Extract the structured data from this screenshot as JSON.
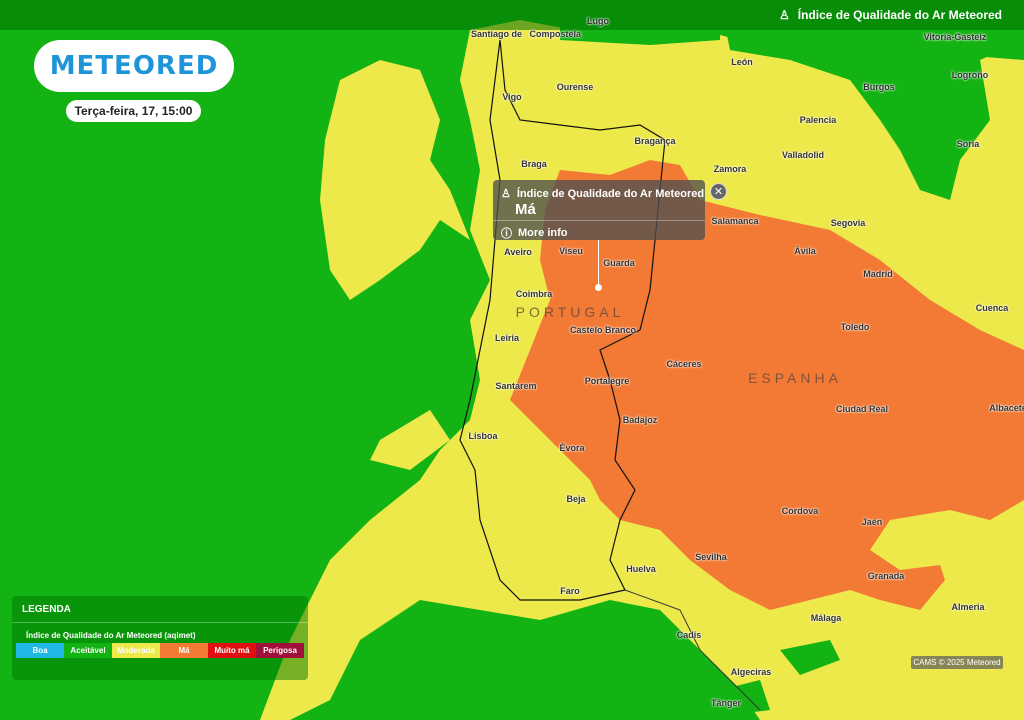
{
  "header": {
    "title": "Índice de Qualidade do Ar Meteored",
    "icon": "air-quality-icon"
  },
  "brand": {
    "logo_text": "METEORED",
    "color": "#1e95d9"
  },
  "time": {
    "label": "Terça-feira, 17, 15:00"
  },
  "popup": {
    "title": "Índice de Qualidade do Ar Meteored",
    "value": "Má",
    "more_info": "More info",
    "close": "✕"
  },
  "map": {
    "countries": [
      {
        "name": "PORTUGAL"
      },
      {
        "name": "ESPANHA"
      }
    ],
    "cities": [
      "Santiago de   Compostela",
      "Lugo",
      "Vitoria-Gasteiz",
      "Ourense",
      "León",
      "Burgos",
      "Logroño",
      "Vigo",
      "Palencia",
      "Soria",
      "Bragança",
      "Braga",
      "Valladolid",
      "Zamora",
      "Salamanca",
      "Segovia",
      "Ávila",
      "Aveiro",
      "Viseu",
      "Guarda",
      "Madrid",
      "Coimbra",
      "Cuenca",
      "Castelo Branco",
      "Toledo",
      "Leiria",
      "Cáceres",
      "Portalegre",
      "Santarem",
      "Badajoz",
      "Ciudad Real",
      "Albacete",
      "Lisboa",
      "Évora",
      "Beja",
      "Cordova",
      "Jaén",
      "Sevilha",
      "Granada",
      "Huelva",
      "Faro",
      "Málaga",
      "Almeria",
      "Cadis",
      "Algeciras",
      "Tânger"
    ]
  },
  "legend": {
    "title": "LEGENDA",
    "subtitle": "Índice de Qualidade do Ar Meteored (aqimet)",
    "levels": [
      {
        "label": "Boa",
        "color": "#21b8e6"
      },
      {
        "label": "Aceitável",
        "color": "#13b313"
      },
      {
        "label": "Moderada",
        "color": "#ede94a"
      },
      {
        "label": "Má",
        "color": "#f27a35"
      },
      {
        "label": "Muito má",
        "color": "#e01010"
      },
      {
        "label": "Perigosa",
        "color": "#a0103a"
      }
    ]
  },
  "credit": "CAMS © 2025 Meteored",
  "colors": {
    "good_area": "#13b313",
    "moderate_area": "#ede94a",
    "bad_area": "#f27a35"
  }
}
